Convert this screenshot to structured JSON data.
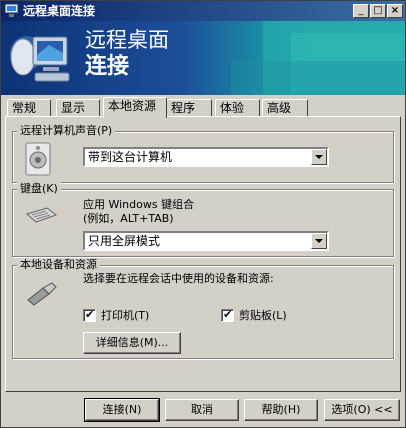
{
  "window": {
    "title": "远程桌面连接"
  },
  "banner": {
    "line1": "远程桌面",
    "line2": "连接"
  },
  "tabs": [
    "常规",
    "显示",
    "本地资源",
    "程序",
    "体验",
    "高级"
  ],
  "sound": {
    "group_label": "远程计算机声音(P)",
    "selected": "带到这台计算机"
  },
  "keyboard": {
    "group_label": "键盘(K)",
    "desc1": "应用 Windows 键组合",
    "desc2": "(例如，ALT+TAB)",
    "selected": "只用全屏模式"
  },
  "devices": {
    "group_label": "本地设备和资源",
    "desc": "选择要在远程会话中使用的设备和资源:",
    "printers_label": "打印机(T)",
    "clipboard_label": "剪贴板(L)",
    "printers_checked": true,
    "clipboard_checked": true,
    "details_label": "详细信息(M)..."
  },
  "buttons": {
    "connect": "连接(N)",
    "cancel": "取消",
    "help": "帮助(H)",
    "options": "选项(O) <<"
  }
}
